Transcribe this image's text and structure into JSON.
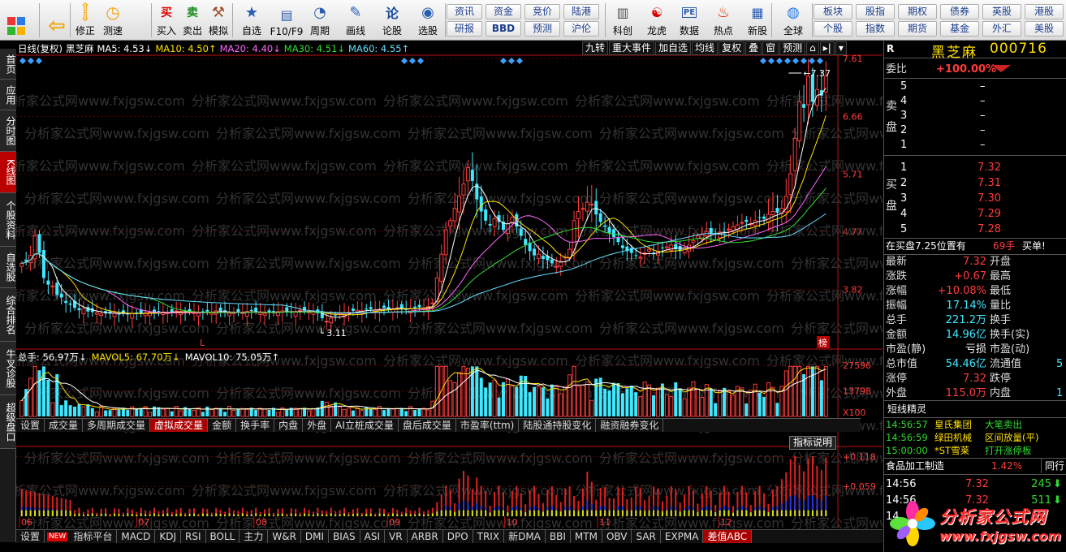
{
  "toolbar": {
    "main_buttons": [
      {
        "label": "",
        "icon": "grid-icon"
      },
      {
        "label": "",
        "icon": "back-arrow-icon"
      },
      {
        "label": "修正",
        "icon": "up-down-arrows-icon"
      },
      {
        "label": "测速",
        "icon": "clock-icon"
      },
      {
        "label": "买入",
        "icon": "buy-icon"
      },
      {
        "label": "卖出",
        "icon": "sell-icon"
      },
      {
        "label": "模拟",
        "icon": "hammer-icon"
      },
      {
        "label": "自选",
        "icon": "star-icon"
      },
      {
        "label": "F10/F9",
        "icon": "f10-icon"
      },
      {
        "label": "周期",
        "icon": "period-icon"
      },
      {
        "label": "画线",
        "icon": "pen-icon"
      },
      {
        "label": "论股",
        "icon": "discuss-icon"
      },
      {
        "label": "选股",
        "icon": "select-stock-icon"
      }
    ],
    "small_buttons_row1": [
      "资讯",
      "资金",
      "竞价",
      "陆港"
    ],
    "small_buttons_row2": [
      "研报",
      "BBD",
      "预测",
      "沪伦"
    ],
    "mid_buttons": [
      {
        "label": "科创",
        "icon": "science-icon"
      },
      {
        "label": "龙虎",
        "icon": "dragon-tiger-icon"
      },
      {
        "label": "数据",
        "icon": "pe-data-icon"
      },
      {
        "label": "热点",
        "icon": "hot-icon"
      },
      {
        "label": "新股",
        "icon": "new-stock-icon"
      },
      {
        "label": "全球",
        "icon": "globe-icon"
      }
    ],
    "right_row1": [
      "板块",
      "股指",
      "期权",
      "债券",
      "英股",
      "港股"
    ],
    "right_row2": [
      "个股",
      "指数",
      "期货",
      "基金",
      "外汇",
      "美股"
    ]
  },
  "left_tabs": [
    "首页",
    "应用",
    "分时图",
    "K线图",
    "个股资料",
    "自选股",
    "综合排名",
    "牛叉诊股",
    "超级盘口"
  ],
  "left_tab_active": "K线图",
  "chart": {
    "ma_legend": [
      {
        "text": "日线(复权)",
        "color": "#ffffff"
      },
      {
        "text": "黑芝麻",
        "color": "#ffffff"
      },
      {
        "text": "MA5: 4.53↓",
        "color": "#ffffff"
      },
      {
        "text": "MA10: 4.50↑",
        "color": "#ffe000"
      },
      {
        "text": "MA20: 4.40↓",
        "color": "#ff66ff"
      },
      {
        "text": "MA30: 4.51↓",
        "color": "#33dd33"
      },
      {
        "text": "MA60: 4.55↑",
        "color": "#66ddff"
      }
    ],
    "buttons": [
      "九转",
      "重大事件",
      "加自选",
      "均线",
      "复权",
      "叠",
      "窗",
      "预测",
      "⌂",
      "▸|",
      "▾"
    ],
    "price_axis": [
      "7.61",
      "6.66",
      "5.71",
      "4.77",
      "3.82"
    ],
    "high_label": "7.37",
    "low_label": "3.11",
    "marker_label": "榜",
    "l_label": "L",
    "vol_legend": [
      {
        "text": "总手: 56.97万↓",
        "color": "#ffffff"
      },
      {
        "text": "MAVOL5: 67.70万↓",
        "color": "#ffe000"
      },
      {
        "text": "MAVOL10: 75.05万↑",
        "color": "#ffffff"
      }
    ],
    "vol_axis": [
      "27596",
      "13798",
      "X100"
    ],
    "vol_tabs": [
      "设置",
      "成交量",
      "多周期成交量",
      "虚拟成交量",
      "金额",
      "换手率",
      "内盘",
      "外盘",
      "AI立桩成交量",
      "盘后成交量",
      "市盈率(ttm)",
      "陆股通持股变化",
      "融资融券变化"
    ],
    "vol_tab_active": "虚拟成交量",
    "indicator_desc": "指标说明",
    "ind_axis": [
      "+0.118",
      "+0.059"
    ],
    "date_axis": [
      "06",
      "07",
      "08",
      "09",
      "10",
      "11",
      "12"
    ],
    "ind_tabs": [
      "设置",
      "NEW",
      "指标平台",
      "MACD",
      "KDJ",
      "RSI",
      "BOLL",
      "主力",
      "W&R",
      "DMI",
      "BIAS",
      "ASI",
      "VR",
      "ARBR",
      "DPO",
      "TRIX",
      "新DMA",
      "BBI",
      "MTM",
      "OBV",
      "SAR",
      "EXPMA",
      "差值ABC"
    ],
    "ind_tab_active": "差值ABC"
  },
  "chart_data": [
    {
      "type": "candlestick",
      "title": "日线(复权) 黑芝麻",
      "x_ticks": [
        "06",
        "07",
        "08",
        "09",
        "10",
        "11",
        "12"
      ],
      "ylim": [
        3.11,
        7.61
      ],
      "y_ticks": [
        7.61,
        6.66,
        5.71,
        4.77,
        3.82
      ],
      "high": 7.37,
      "low": 3.11,
      "close": [
        4.25,
        4.28,
        4.38,
        4.7,
        4.42,
        4.01,
        3.9,
        3.88,
        3.73,
        3.69,
        3.6,
        3.57,
        3.52,
        3.48,
        3.51,
        3.46,
        3.45,
        3.44,
        3.42,
        3.43,
        3.43,
        3.44,
        3.42,
        3.43,
        3.41,
        3.43,
        3.44,
        3.42,
        3.44,
        3.45,
        3.43,
        3.46,
        3.45,
        3.44,
        3.45,
        3.47,
        3.46,
        3.44,
        3.45,
        3.44,
        3.43,
        3.44,
        3.46,
        3.45,
        3.47,
        3.46,
        3.45,
        3.43,
        3.44,
        3.45,
        3.44,
        3.46,
        3.47,
        3.45,
        3.44,
        3.43,
        3.44,
        3.45,
        3.46,
        3.47,
        3.46,
        3.44,
        3.45,
        3.48,
        3.47,
        3.46,
        3.45,
        3.43,
        3.35,
        3.3,
        3.35,
        3.4,
        3.43,
        3.44,
        3.45,
        3.47,
        3.48,
        3.47,
        3.49,
        3.5,
        3.48,
        3.5,
        3.52,
        3.51,
        3.5,
        3.52,
        3.51,
        3.49,
        3.51,
        3.52,
        3.53,
        3.52,
        3.54,
        3.6,
        4.01,
        4.4,
        4.8,
        4.95,
        5.15,
        5.35,
        5.55,
        5.82,
        5.6,
        5.3,
        5.1,
        4.95,
        4.87,
        4.98,
        4.93,
        4.8,
        4.9,
        5.0,
        4.85,
        4.7,
        4.55,
        4.45,
        4.38,
        4.4,
        4.32,
        4.3,
        4.25,
        4.2,
        4.28,
        4.35,
        4.48,
        4.95,
        5.1,
        5.15,
        5.25,
        5.22,
        5.05,
        4.93,
        4.85,
        4.75,
        4.68,
        4.6,
        4.5,
        4.45,
        4.42,
        4.38,
        4.35,
        4.42,
        4.48,
        4.4,
        4.45,
        4.5,
        4.52,
        4.55,
        4.48,
        4.45,
        4.5,
        4.55,
        4.62,
        4.7,
        4.72,
        4.77,
        4.74,
        4.73,
        4.76,
        4.75,
        4.81,
        4.85,
        4.88,
        4.92,
        4.93,
        4.9,
        4.95,
        5.0,
        4.98,
        5.05,
        5.1,
        5.08,
        5.15,
        5.35,
        5.72,
        6.3,
        6.9,
        6.8,
        7.32,
        6.9,
        7.1,
        7.0,
        7.32
      ],
      "series": [
        {
          "name": "MA5",
          "last": 4.53
        },
        {
          "name": "MA10",
          "last": 4.5
        },
        {
          "name": "MA20",
          "last": 4.4
        },
        {
          "name": "MA30",
          "last": 4.51
        },
        {
          "name": "MA60",
          "last": 4.55
        }
      ]
    },
    {
      "type": "bar",
      "title": "虚拟成交量",
      "y_ticks": [
        27596,
        13798
      ],
      "unit": "X100",
      "series": [
        {
          "name": "总手",
          "last": "56.97万"
        },
        {
          "name": "MAVOL5",
          "last": "67.70万"
        },
        {
          "name": "MAVOL10",
          "last": "75.05万"
        }
      ]
    },
    {
      "type": "bar",
      "title": "差值ABC",
      "y_ticks": [
        0.118,
        0.059
      ]
    }
  ],
  "quote": {
    "code_label": "R",
    "stock_name": "黑芝麻",
    "stock_code": "000716",
    "weibi_label": "委比",
    "weibi_value": "+100.00%",
    "sell_label": "卖盘",
    "buy_label": "买盘",
    "asks": [
      {
        "level": "5",
        "price": "–",
        "vol": ""
      },
      {
        "level": "4",
        "price": "–",
        "vol": ""
      },
      {
        "level": "3",
        "price": "–",
        "vol": ""
      },
      {
        "level": "2",
        "price": "–",
        "vol": ""
      },
      {
        "level": "1",
        "price": "–",
        "vol": ""
      }
    ],
    "bids": [
      {
        "level": "1",
        "price": "7.32",
        "vol": ""
      },
      {
        "level": "2",
        "price": "7.31",
        "vol": ""
      },
      {
        "level": "3",
        "price": "7.30",
        "vol": ""
      },
      {
        "level": "4",
        "price": "7.29",
        "vol": ""
      },
      {
        "level": "5",
        "price": "7.28",
        "vol": ""
      }
    ],
    "queue_text": "在买盘7.25位置有",
    "queue_vol": "69手",
    "queue_action": "买单!",
    "stats": [
      {
        "l1": "最新",
        "v1": "7.32",
        "c1": "red",
        "l2": "开盘",
        "v2": ""
      },
      {
        "l1": "涨跌",
        "v1": "+0.67",
        "c1": "red",
        "l2": "最高",
        "v2": ""
      },
      {
        "l1": "涨幅",
        "v1": "+10.08%",
        "c1": "red",
        "l2": "最低",
        "v2": ""
      },
      {
        "l1": "振幅",
        "v1": "17.14%",
        "c1": "cyan",
        "l2": "量比",
        "v2": ""
      },
      {
        "l1": "总手",
        "v1": "221.2万",
        "c1": "cyan",
        "l2": "换手",
        "v2": ""
      },
      {
        "l1": "金额",
        "v1": "14.96亿",
        "c1": "cyan",
        "l2": "换手(实)",
        "v2": ""
      },
      {
        "l1": "市盈(静)",
        "v1": "亏损",
        "c1": "white",
        "l2": "市盈(动)",
        "v2": ""
      },
      {
        "l1": "总市值",
        "v1": "54.46亿",
        "c1": "cyan",
        "l2": "流通值",
        "v2": "5"
      },
      {
        "l1": "涨停",
        "v1": "7.32",
        "c1": "red",
        "l2": "跌停",
        "v2": ""
      },
      {
        "l1": "外盘",
        "v1": "115.0万",
        "c1": "red",
        "l2": "内盘",
        "v2": "1"
      }
    ],
    "short_title": "短线精灵",
    "short_items": [
      {
        "time": "14:56:57",
        "name": "皇氏集团",
        "event": "大笔卖出",
        "color": "green"
      },
      {
        "time": "14:56:59",
        "name": "绿田机械",
        "event": "区间放量(平)",
        "color": "yellow"
      },
      {
        "time": "15:00:00",
        "name": "*ST雪莱",
        "event": "打开涨停板",
        "color": "green"
      }
    ],
    "industry_name": "食品加工制造",
    "industry_change": "1.42%",
    "industry_btn": "同行",
    "ticks": [
      {
        "time": "14:56",
        "price": "7.32",
        "vol": "245",
        "dir": "down"
      },
      {
        "time": "14:56",
        "price": "7.32",
        "vol": "511",
        "dir": "down"
      },
      {
        "time": "14",
        "price": "",
        "vol": "",
        "dir": ""
      }
    ]
  },
  "logo": {
    "name": "分析家公式网",
    "url": "www.fxjgsw.com"
  },
  "watermark": "分析家公式网www.fxjgsw.com"
}
